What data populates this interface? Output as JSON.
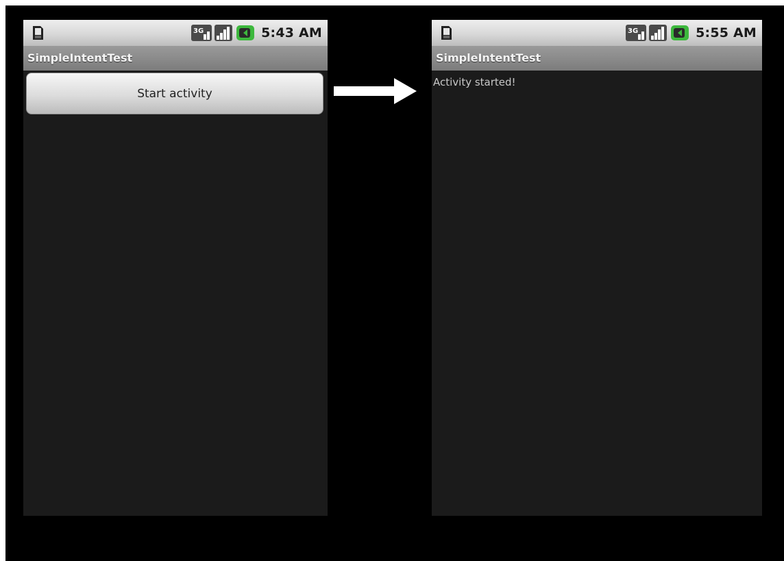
{
  "left_screen": {
    "status": {
      "time": "5:43 AM",
      "network": "3G"
    },
    "app_title": "SimpleIntentTest",
    "start_button_label": "Start activity"
  },
  "right_screen": {
    "status": {
      "time": "5:55 AM",
      "network": "3G"
    },
    "app_title": "SimpleIntentTest",
    "message": "Activity started!"
  },
  "icons": {
    "sd_card": "sd-card-icon",
    "network": "3g-network-icon",
    "signal": "signal-strength-icon",
    "battery": "battery-charging-icon",
    "transition": "right-arrow-icon"
  },
  "colors": {
    "background": "#000000",
    "screen_background": "#1b1b1b",
    "battery_green": "#3db83d",
    "message_text": "#c8c8c8"
  }
}
